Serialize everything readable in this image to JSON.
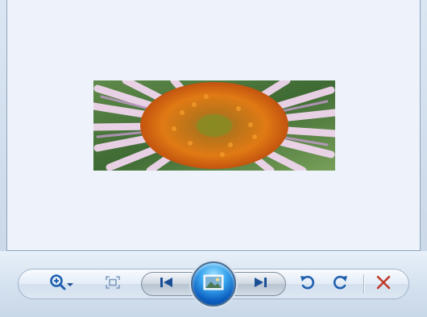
{
  "photo": {
    "description_icon": "flower-image"
  },
  "toolbar": {
    "zoom": {
      "icon": "zoom-in-icon",
      "dropdown_icon": "chevron-down-icon"
    },
    "actual_size": {
      "icon": "fit-to-window-icon"
    },
    "previous": {
      "icon": "previous-icon"
    },
    "slideshow": {
      "icon": "slideshow-icon"
    },
    "next": {
      "icon": "next-icon"
    },
    "rotate_ccw": {
      "icon": "rotate-counterclockwise-icon"
    },
    "rotate_cw": {
      "icon": "rotate-clockwise-icon"
    },
    "delete": {
      "icon": "delete-icon"
    }
  },
  "colors": {
    "accent_blue": "#1f5fb0",
    "delete_red": "#c0392b",
    "viewport_bg": "#eef3fb"
  }
}
